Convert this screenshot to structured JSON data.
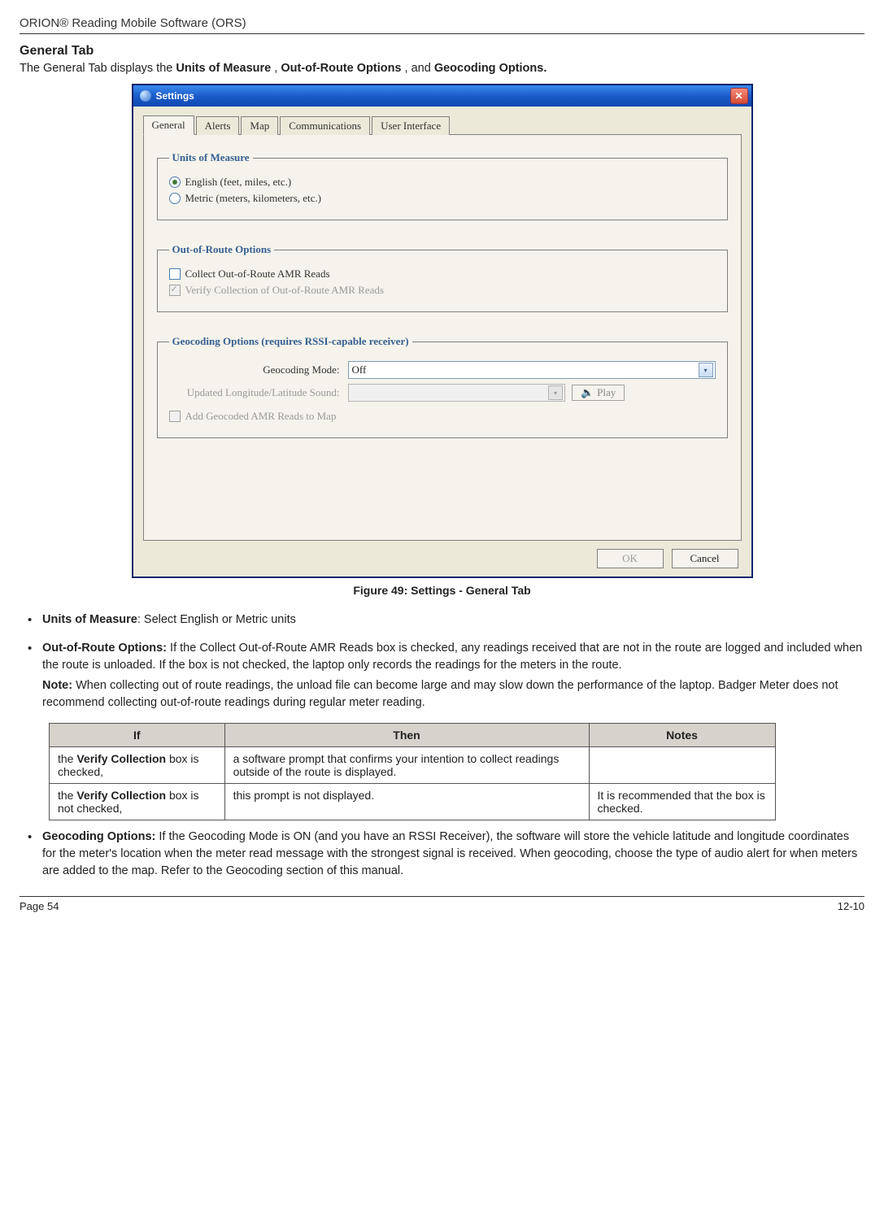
{
  "header": {
    "product": "ORION® Reading Mobile Software (ORS)"
  },
  "section": {
    "title": "General Tab",
    "intro_pre": "The General Tab displays the ",
    "intro_b1": "Units of Measure",
    "intro_mid1": ", ",
    "intro_b2": "Out-of-Route Options",
    "intro_mid2": ", and ",
    "intro_b3": "Geocoding Options.",
    "intro_post": ""
  },
  "dialog": {
    "title": "Settings",
    "tabs": [
      "General",
      "Alerts",
      "Map",
      "Communications",
      "User Interface"
    ],
    "groups": {
      "units": {
        "legend": "Units of Measure",
        "opt_english": "English (feet, miles, etc.)",
        "opt_metric": "Metric (meters, kilometers, etc.)"
      },
      "oor": {
        "legend": "Out-of-Route Options",
        "collect": "Collect Out-of-Route AMR Reads",
        "verify": "Verify Collection of Out-of-Route AMR Reads"
      },
      "geo": {
        "legend": "Geocoding Options (requires RSSI-capable receiver)",
        "mode_label": "Geocoding Mode:",
        "mode_value": "Off",
        "sound_label": "Updated Longitude/Latitude Sound:",
        "play": "Play",
        "addmap": "Add Geocoded AMR Reads to Map"
      }
    },
    "buttons": {
      "ok": "OK",
      "cancel": "Cancel"
    }
  },
  "figure": {
    "caption": "Figure 49:  Settings - General Tab"
  },
  "bullets": {
    "b1_bold": "Units of Measure",
    "b1_rest": ":  Select English or Metric units",
    "b2_bold": "Out-of-Route Options:",
    "b2_rest": "  If the Collect Out-of-Route AMR Reads box is checked, any readings received that are not in the route are logged and included when the route is unloaded.  If the box is not checked, the laptop only records the readings for the meters in the route.",
    "b2_note_bold": "Note:",
    "b2_note_rest": "  When collecting out of route readings, the unload file can become large and may slow down the performance of the laptop.  Badger Meter does not recommend collecting out-of-route readings during regular meter reading.",
    "b3_bold": "Geocoding Options:",
    "b3_rest": "  If the Geocoding Mode is ON (and you have an RSSI Receiver), the software will store the vehicle latitude and longitude coordinates for the meter's location when the meter read message with the strongest signal is received. When geocoding, choose the type of audio alert for when meters are added to the map. Refer to the Geocoding section of this manual."
  },
  "table": {
    "head": {
      "if": "If",
      "then": "Then",
      "notes": "Notes"
    },
    "rows": [
      {
        "if_pre": "the ",
        "if_bold": "Verify Collection",
        "if_post": " box is checked,",
        "then": "a software prompt that confirms your intention to collect readings outside of the route is displayed.",
        "notes": ""
      },
      {
        "if_pre": "the ",
        "if_bold": "Verify Collection",
        "if_post": " box is not checked,",
        "then": "this prompt is not displayed.",
        "notes": "It is recommended that the box is checked."
      }
    ]
  },
  "footer": {
    "page": "Page 54",
    "rev": "12-10"
  }
}
